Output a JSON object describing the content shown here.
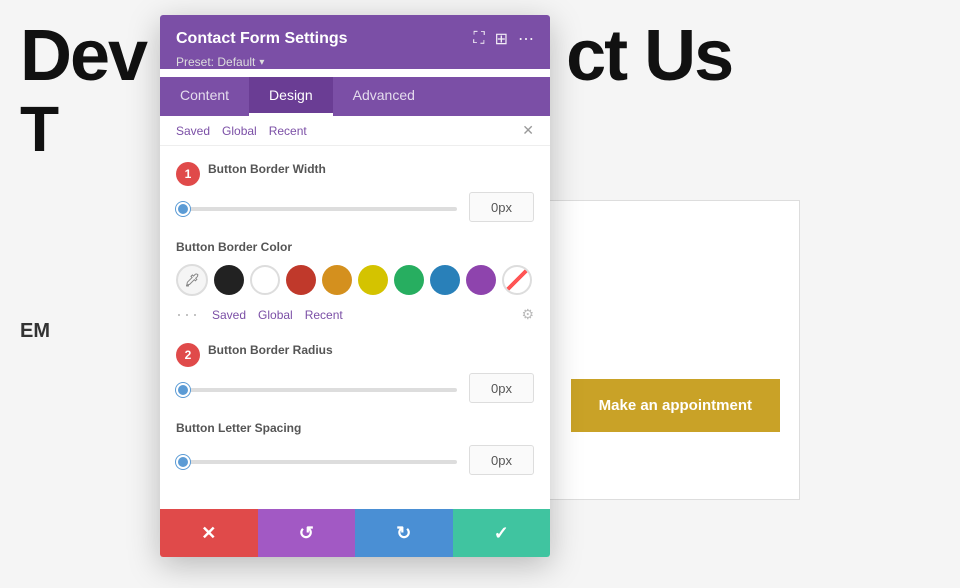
{
  "background": {
    "title": "Dev",
    "title_suffix": "ct Us",
    "subtitle": "T",
    "em_label": "EM"
  },
  "appointment_button": {
    "label": "Make an appointment"
  },
  "panel": {
    "title": "Contact Form Settings",
    "preset_label": "Preset: Default",
    "icons": {
      "expand": "⛶",
      "columns": "⊞",
      "more": "⋯"
    },
    "tabs": [
      {
        "label": "Content",
        "active": false
      },
      {
        "label": "Design",
        "active": true
      },
      {
        "label": "Advanced",
        "active": false
      }
    ],
    "sub_tabs": [
      "Saved",
      "Global",
      "Recent"
    ],
    "sections": {
      "border_width": {
        "label": "Button Border Width",
        "value": "0px",
        "slider_pct": 0
      },
      "border_color": {
        "label": "Button Border Color",
        "swatches": [
          {
            "color": "#222222",
            "label": "black"
          },
          {
            "color": "#ffffff",
            "label": "white"
          },
          {
            "color": "#c0392b",
            "label": "red"
          },
          {
            "color": "#d4901e",
            "label": "orange"
          },
          {
            "color": "#d4c300",
            "label": "yellow"
          },
          {
            "color": "#27ae60",
            "label": "green"
          },
          {
            "color": "#2980b9",
            "label": "blue"
          },
          {
            "color": "#8e44ad",
            "label": "purple"
          }
        ],
        "sub_tabs": [
          "Saved",
          "Global",
          "Recent"
        ]
      },
      "border_radius": {
        "label": "Button Border Radius",
        "value": "0px",
        "slider_pct": 0
      },
      "letter_spacing": {
        "label": "Button Letter Spacing",
        "value": "0px",
        "slider_pct": 0
      }
    },
    "footer": {
      "cancel_icon": "✕",
      "reset_icon": "↺",
      "redo_icon": "↻",
      "save_icon": "✓"
    },
    "steps": {
      "step1": {
        "number": "1",
        "color": "#e04a4a"
      },
      "step2": {
        "number": "2",
        "color": "#e04a4a"
      }
    }
  }
}
